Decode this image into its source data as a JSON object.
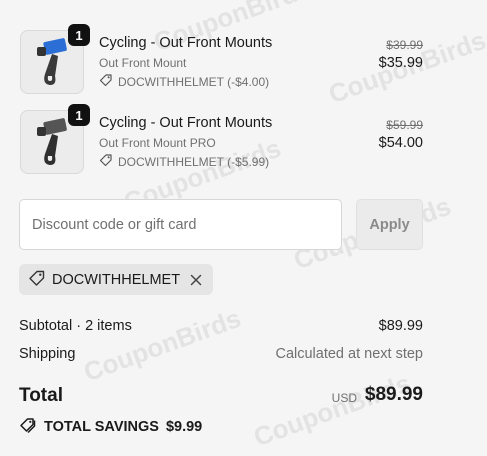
{
  "watermark": "CouponBirds",
  "items": [
    {
      "quantity": "1",
      "title": "Cycling - Out Front Mounts",
      "variant": "Out Front Mount",
      "discount": "DOCWITHHELMET (-$4.00)",
      "original_price": "$39.99",
      "price": "$35.99",
      "accent": "#2b6fd6"
    },
    {
      "quantity": "1",
      "title": "Cycling - Out Front Mounts",
      "variant": "Out Front Mount PRO",
      "discount": "DOCWITHHELMET (-$5.99)",
      "original_price": "$59.99",
      "price": "$54.00",
      "accent": "#555555"
    }
  ],
  "discount_field": {
    "placeholder": "Discount code or gift card",
    "apply_label": "Apply"
  },
  "applied_code": "DOCWITHHELMET",
  "summary": {
    "subtotal_label": "Subtotal · 2 items",
    "subtotal_value": "$89.99",
    "shipping_label": "Shipping",
    "shipping_value": "Calculated at next step",
    "total_label": "Total",
    "currency": "USD",
    "total_value": "$89.99",
    "savings_label": "TOTAL SAVINGS",
    "savings_value": "$9.99"
  },
  "icons": {
    "tag": "tag-icon",
    "remove": "close-icon",
    "savings": "price-tags-icon"
  }
}
